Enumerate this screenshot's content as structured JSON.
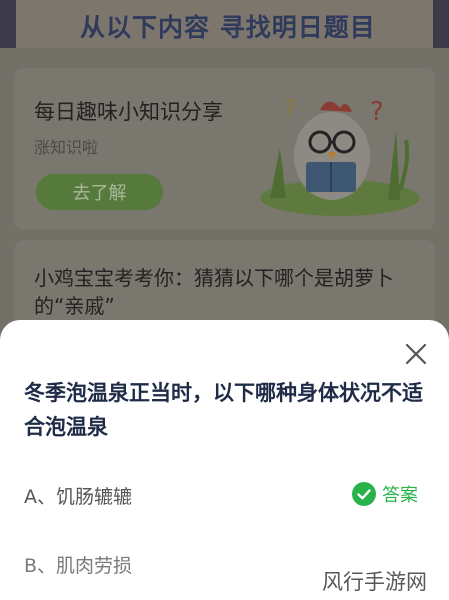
{
  "banner": {
    "title": "从以下内容 寻找明日题目"
  },
  "card1": {
    "title": "每日趣味小知识分享",
    "subtitle": "涨知识啦",
    "button_label": "去了解"
  },
  "card2": {
    "title": "小鸡宝宝考考你：猜猜以下哪个是胡萝卜的“亲戚”"
  },
  "sheet": {
    "question": "冬季泡温泉正当时，以下哪种身体状况不适合泡温泉",
    "options": [
      {
        "label": "A、饥肠辘辘"
      },
      {
        "label": "B、肌肉劳损"
      }
    ],
    "answer_label": "答案"
  },
  "watermark": "风行手游网",
  "colors": {
    "answer_green": "#27b34a",
    "question_text": "#1f2b47",
    "overlay_background": "#737068"
  },
  "icons": {
    "close": "close-icon",
    "answer": "check-circle-icon",
    "mascot": "chick-mascot-illustration"
  }
}
